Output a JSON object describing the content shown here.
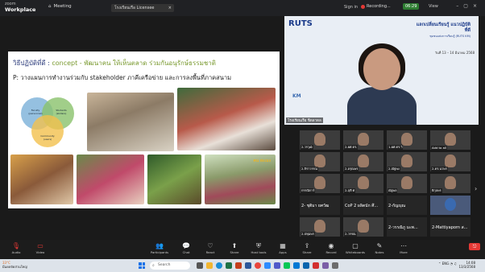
{
  "app": {
    "brand_top": "zoom",
    "brand_bottom": "Workplace",
    "meeting_label": "Meeting",
    "tab_title": "โรงเรียนเรือ Licensee"
  },
  "topbar": {
    "sign_in": "Sign in",
    "recording": "Recording...",
    "timer": "06:29",
    "view": "View"
  },
  "slide": {
    "title_th": "วิธีปฏิบัติที่ดี : ",
    "title_rest": "concept - พัฒนาคน ให้เห็นตลาด ร่วมกันอนุรักษ์ธรรมชาติ",
    "subtitle": "P: วางแผนการทำงานร่วมกับ stakeholder ภาคีเครือข่าย และการลงพื้นที่ภาคสนาม",
    "venn": {
      "a": "Faculty (personnel)",
      "b": "Students (skillers)",
      "c": "Community (users)"
    },
    "photo_sign": "คน สะเมง"
  },
  "speaker": {
    "brand": "RUTS",
    "banner_title": "แลกเปลี่ยนเรียนรู้ แนวปฏิบัติที่ดี",
    "banner_sub": "ชุมชนแห่งการเรียนรู้ (RUTS KM)",
    "date": "วันที่ 13 – 14 มีนาคม 2568",
    "km": "KM",
    "name": "โรงเรียนเรือ ชิดลาดล"
  },
  "tiles": [
    {
      "label": "2-วรวุฒิ",
      "text": ""
    },
    {
      "label": "2-ผศ.ดร.",
      "text": ""
    },
    {
      "label": "1-ผศ.ดร.วิ",
      "text": ""
    },
    {
      "label": "Add to all",
      "text": ""
    },
    {
      "label": "2-จิราวรรณ",
      "text": ""
    },
    {
      "label": "2-อรุณพร",
      "text": ""
    },
    {
      "label": "2-ณัฐพง",
      "text": ""
    },
    {
      "label": "2-ดร.นวพร",
      "text": ""
    },
    {
      "label": "กรรณิการ์",
      "text": ""
    },
    {
      "label": "2-ฤดี ศ",
      "text": ""
    },
    {
      "label": "ณัฐพล",
      "text": ""
    },
    {
      "label": "ธิกุลพร",
      "text": ""
    },
    {
      "label": "",
      "text": "2- ชุติมา ยศวัฒ"
    },
    {
      "label": "",
      "text": "CoP 2 ผลิตนัก ศึ..."
    },
    {
      "label": "",
      "text": "2-กัญญุณ"
    },
    {
      "label": "",
      "text": ""
    },
    {
      "label": "2-ปทุมพร",
      "text": ""
    },
    {
      "label": "2-วรรณ",
      "text": ""
    },
    {
      "label": "",
      "text": "2-วรรณิภู มะพ..."
    },
    {
      "label": "",
      "text": "2-Mattiyaporn ส..."
    }
  ],
  "toolbar": {
    "items": [
      "Audio",
      "Video",
      "Participants",
      "Chat",
      "React",
      "Share",
      "Host tools",
      "Apps",
      "Share",
      "Record",
      "Whiteboards",
      "Notes",
      "More"
    ],
    "leave": "Leave"
  },
  "taskbar": {
    "temp": "33°C",
    "weather": "มีแดดจัดส่วนใหญ่",
    "search": "Search",
    "time": "14:08",
    "date": "13/3/2568"
  }
}
